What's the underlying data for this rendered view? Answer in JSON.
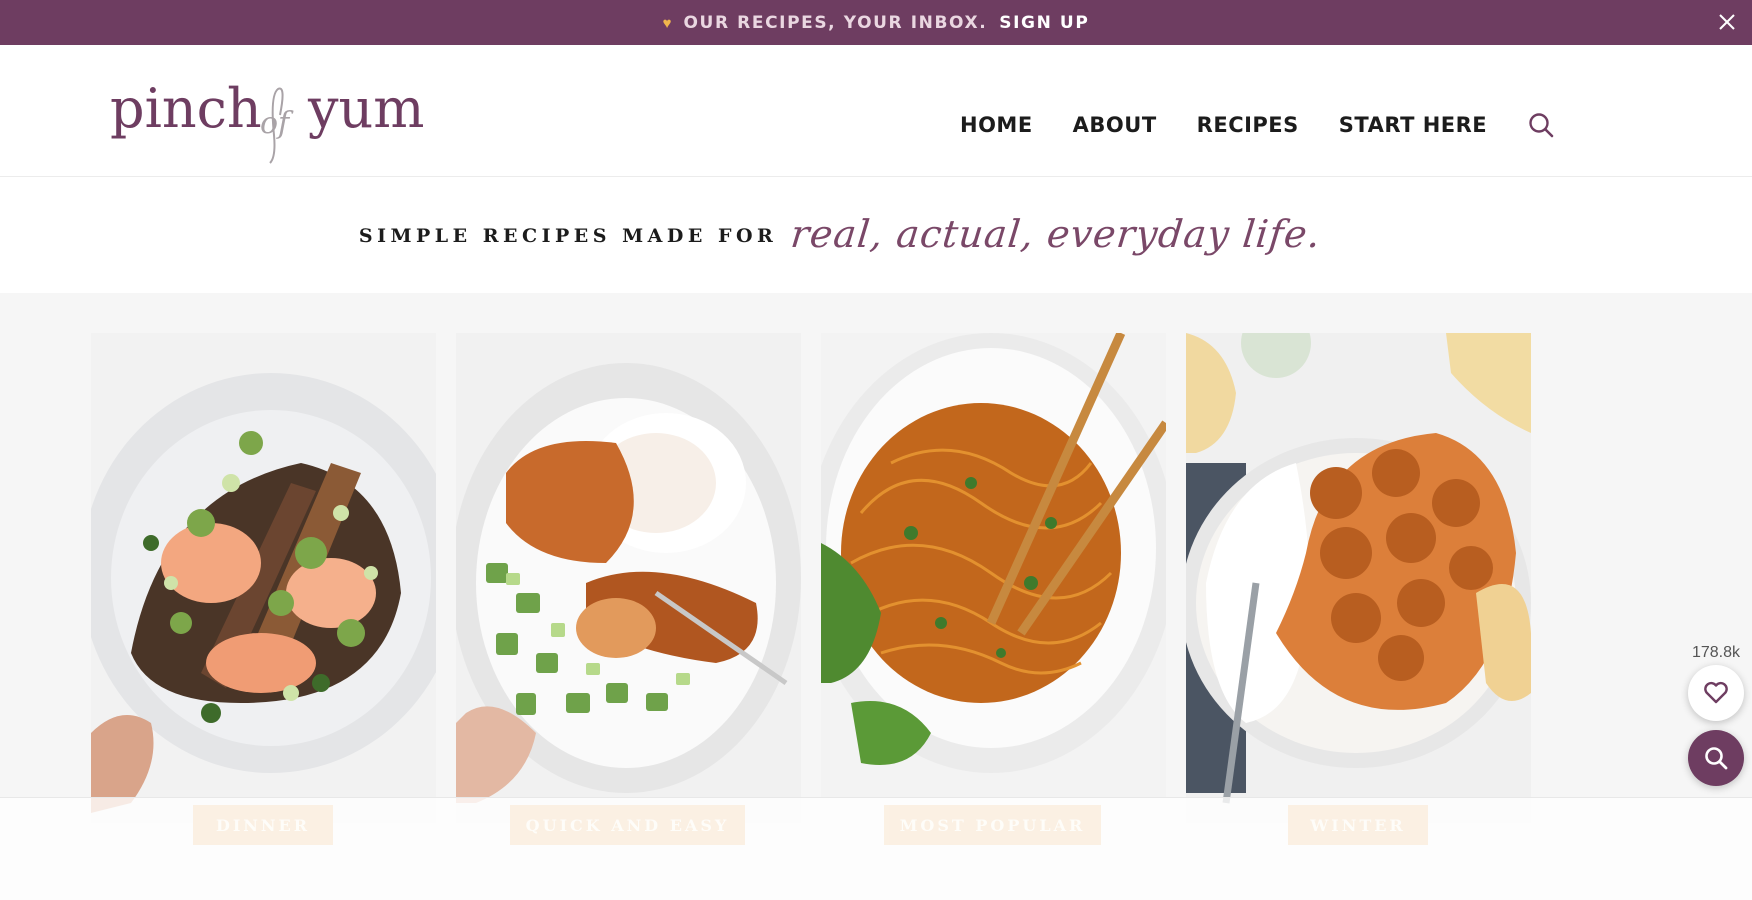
{
  "announcement": {
    "message": "OUR RECIPES, YOUR INBOX.",
    "cta": "SIGN UP",
    "heart_icon": "heart-icon",
    "close_icon": "close-icon"
  },
  "header": {
    "logo": "pinch of yum",
    "nav": [
      {
        "label": "HOME"
      },
      {
        "label": "ABOUT"
      },
      {
        "label": "RECIPES"
      },
      {
        "label": "START HERE"
      }
    ],
    "search_icon": "search-icon"
  },
  "tagline": {
    "prefix": "SIMPLE RECIPES MADE FOR",
    "script": "real, actual, everyday life."
  },
  "categories": [
    {
      "label": "DINNER",
      "image": "blackened-fish-tacos-on-white-plate"
    },
    {
      "label": "QUICK AND EASY",
      "image": "salmon-rice-cucumber-bowl"
    },
    {
      "label": "MOST POPULAR",
      "image": "spicy-noodles-with-chopsticks"
    },
    {
      "label": "WINTER",
      "image": "meatballs-curry-rice-naan"
    }
  ],
  "floating": {
    "favorites_count": "178.8k",
    "favorite_icon": "heart-outline-icon",
    "search_icon": "search-icon"
  },
  "colors": {
    "brand_plum": "#6e3d61",
    "accent_gold": "#f0b64c",
    "pill_cream": "#fbefe1"
  }
}
